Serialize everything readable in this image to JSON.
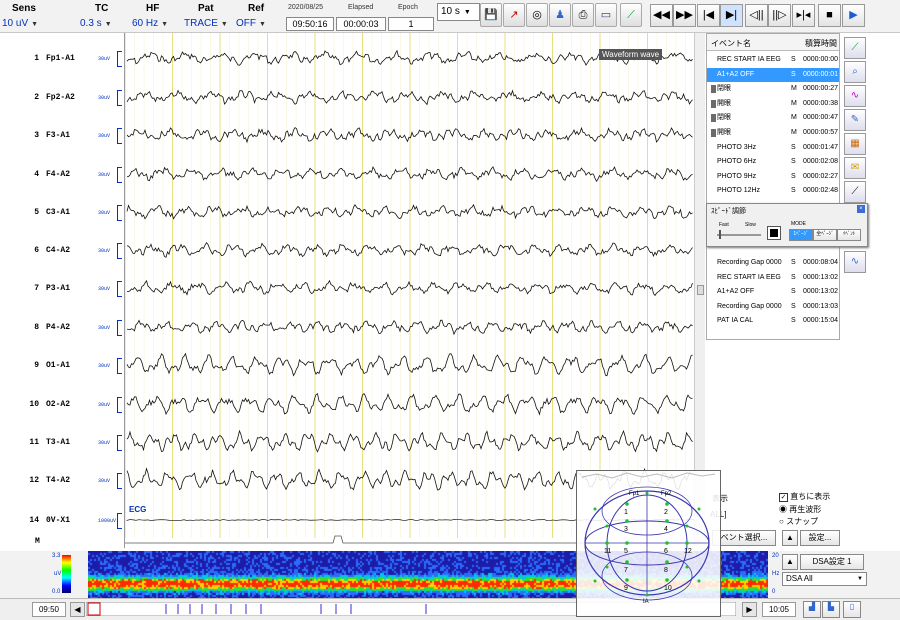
{
  "toolbar": {
    "sens": {
      "label": "Sens",
      "value": "10 uV"
    },
    "tc": {
      "label": "TC",
      "value": "0.3 s"
    },
    "hf": {
      "label": "HF",
      "value": "60 Hz"
    },
    "pat": {
      "label": "Pat",
      "value": "TRACE"
    },
    "ref": {
      "label": "Ref",
      "value": "OFF"
    },
    "date": "2020/08/25",
    "clock": "09:50:16",
    "elapsed_label": "Elapsed",
    "elapsed": "00:00:03",
    "epoch_label": "Epoch",
    "epoch": "1",
    "page_span": "10 s",
    "icons": [
      "save-icon",
      "montage-on-icon",
      "target-icon",
      "person-icon",
      "print-icon",
      "monitor-icon",
      "chart-icon"
    ],
    "playback": [
      "rewind-fast-icon",
      "forward-fast-icon",
      "step-back-icon",
      "step-forward-icon",
      "frame-back-icon",
      "frame-forward-icon",
      "collapse-icon",
      "stop-icon",
      "play-icon"
    ]
  },
  "channels": [
    {
      "num": "1",
      "name": "Fp1-A1",
      "scale": "30uV"
    },
    {
      "num": "2",
      "name": "Fp2-A2",
      "scale": "30uV"
    },
    {
      "num": "3",
      "name": "F3-A1",
      "scale": "30uV"
    },
    {
      "num": "4",
      "name": "F4-A2",
      "scale": "30uV"
    },
    {
      "num": "5",
      "name": "C3-A1",
      "scale": "30uV"
    },
    {
      "num": "6",
      "name": "C4-A2",
      "scale": "30uV"
    },
    {
      "num": "7",
      "name": "P3-A1",
      "scale": "30uV"
    },
    {
      "num": "8",
      "name": "P4-A2",
      "scale": "30uV"
    },
    {
      "num": "9",
      "name": "O1-A1",
      "scale": "30uV"
    },
    {
      "num": "10",
      "name": "O2-A2",
      "scale": "30uV"
    },
    {
      "num": "11",
      "name": "T3-A1",
      "scale": "30uV"
    },
    {
      "num": "12",
      "name": "T4-A2",
      "scale": "30uV"
    },
    {
      "num": "14",
      "name": "0V-X1",
      "scale": "1000uV"
    }
  ],
  "marker_row": "M",
  "ecg_label": "ECG",
  "overlay_label": "Waveform wave",
  "events": {
    "col_name": "イベント名",
    "col_time": "積算時間",
    "rows": [
      {
        "name": "REC START IA EEG",
        "type": "S",
        "time": "0000:00:00",
        "icon": false,
        "selected": false
      },
      {
        "name": "A1+A2 OFF",
        "type": "S",
        "time": "0000:00:01",
        "icon": false,
        "selected": true
      },
      {
        "name": "閉眼",
        "type": "M",
        "time": "0000:00:27",
        "icon": true,
        "selected": false
      },
      {
        "name": "開眼",
        "type": "M",
        "time": "0000:00:38",
        "icon": true,
        "selected": false
      },
      {
        "name": "閉眼",
        "type": "M",
        "time": "0000:00:47",
        "icon": true,
        "selected": false
      },
      {
        "name": "開眼",
        "type": "M",
        "time": "0000:00:57",
        "icon": true,
        "selected": false
      },
      {
        "name": "PHOTO 3Hz",
        "type": "S",
        "time": "0000:01:47",
        "icon": false,
        "selected": false
      },
      {
        "name": "PHOTO 6Hz",
        "type": "S",
        "time": "0000:02:08",
        "icon": false,
        "selected": false
      },
      {
        "name": "PHOTO 9Hz",
        "type": "S",
        "time": "0000:02:27",
        "icon": false,
        "selected": false
      },
      {
        "name": "PHOTO 12Hz",
        "type": "S",
        "time": "0000:02:48",
        "icon": false,
        "selected": false
      }
    ],
    "rows2": [
      {
        "name": "Recording Gap 0000",
        "type": "S",
        "time": "0000:08:04"
      },
      {
        "name": "REC START IA EEG",
        "type": "S",
        "time": "0000:13:02"
      },
      {
        "name": "A1+A2 OFF",
        "type": "S",
        "time": "0000:13:02"
      },
      {
        "name": "Recording Gap 0000",
        "type": "S",
        "time": "0000:13:03"
      },
      {
        "name": "PAT IA CAL",
        "type": "S",
        "time": "0000:15:04"
      }
    ]
  },
  "speed": {
    "title": "ｽﾋﾟｰﾄﾞ調節",
    "fast": "Fast",
    "slow": "Slow",
    "mode_label": "MODE",
    "modes": [
      "1ﾍﾟｰｼﾞ",
      "全ﾍﾟｰｼﾞ",
      "ｲﾍﾞﾝﾄ"
    ]
  },
  "options": {
    "display_label": "表示",
    "immediate_label": "直ちに表示",
    "playback_wave": "再生波形",
    "snap": "スナップ",
    "all_label": "ALL]",
    "event_select": "ベント選択...",
    "settings": "設定..."
  },
  "topo": {
    "electrodes": [
      "1",
      "2",
      "3",
      "4",
      "5",
      "6",
      "7",
      "8",
      "9",
      "10",
      "11",
      "12"
    ],
    "top_labels": [
      "Fp1",
      "Fp2"
    ],
    "bottom_label": "IA"
  },
  "dsa": {
    "scale_top": "3.3",
    "scale_unit": "uV",
    "scale_bottom": "0.0",
    "hz_top": "20",
    "hz_unit": "Hz",
    "hz_bottom": "0",
    "setting_button": "DSA設定 1",
    "select_value": "DSA All"
  },
  "bottom": {
    "start_time": "09:50",
    "end_time": "10:05"
  },
  "colors": {
    "accent_blue": "#0030c0",
    "selection": "#3399ff",
    "grid_yellow": "#e8e07a"
  }
}
